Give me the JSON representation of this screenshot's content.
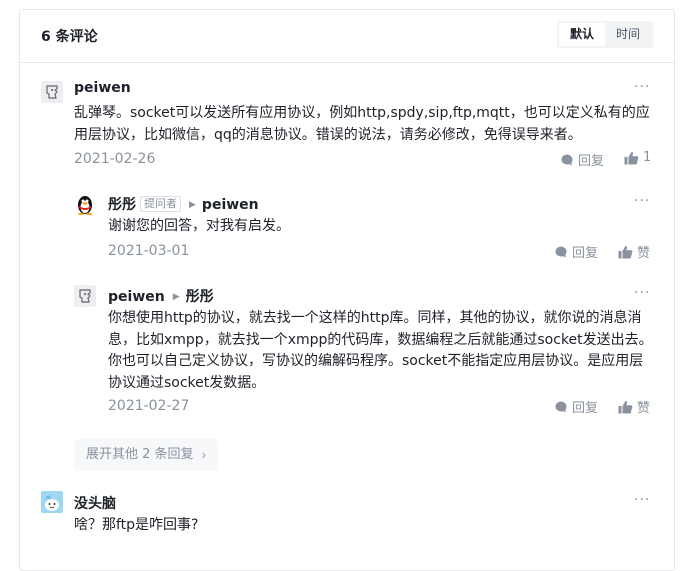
{
  "header": {
    "count": "6 条评论",
    "sort": [
      {
        "label": "默认",
        "active": true
      },
      {
        "label": "时间",
        "active": false
      }
    ]
  },
  "comments": [
    {
      "user": "peiwen",
      "text": "乱弹琴。socket可以发送所有应用协议，例如http,spdy,sip,ftp,mqtt，也可以定义私有的应用层协议，比如微信，qq的消息协议。错误的说法，请务必修改，免得误导来者。",
      "date": "2021-02-26",
      "reply_label": "回复",
      "like_label": "1"
    },
    {
      "user": "彤彤",
      "tag": "提问者",
      "reply_to": "peiwen",
      "text": "谢谢您的回答，对我有启发。",
      "date": "2021-03-01",
      "reply_label": "回复",
      "like_label": "赞"
    },
    {
      "user": "peiwen",
      "reply_to": "彤彤",
      "text": "你想使用http的协议，就去找一个这样的http库。同样，其他的协议，就你说的消息消息，比如xmpp，就去找一个xmpp的代码库，数据编程之后就能通过socket发送出去。你也可以自己定义协议，写协议的编解码程序。socket不能指定应用层协议。是应用层协议通过socket发数据。",
      "date": "2021-02-27",
      "reply_label": "回复",
      "like_label": "赞"
    },
    {
      "user": "没头脑",
      "text": "啥？那ftp是咋回事?"
    }
  ],
  "expand_label": "展开其他 2 条回复",
  "more_label": "···",
  "colors": {
    "accent": "#1d2129",
    "muted": "#8a919f",
    "border": "#e6e8eb"
  }
}
